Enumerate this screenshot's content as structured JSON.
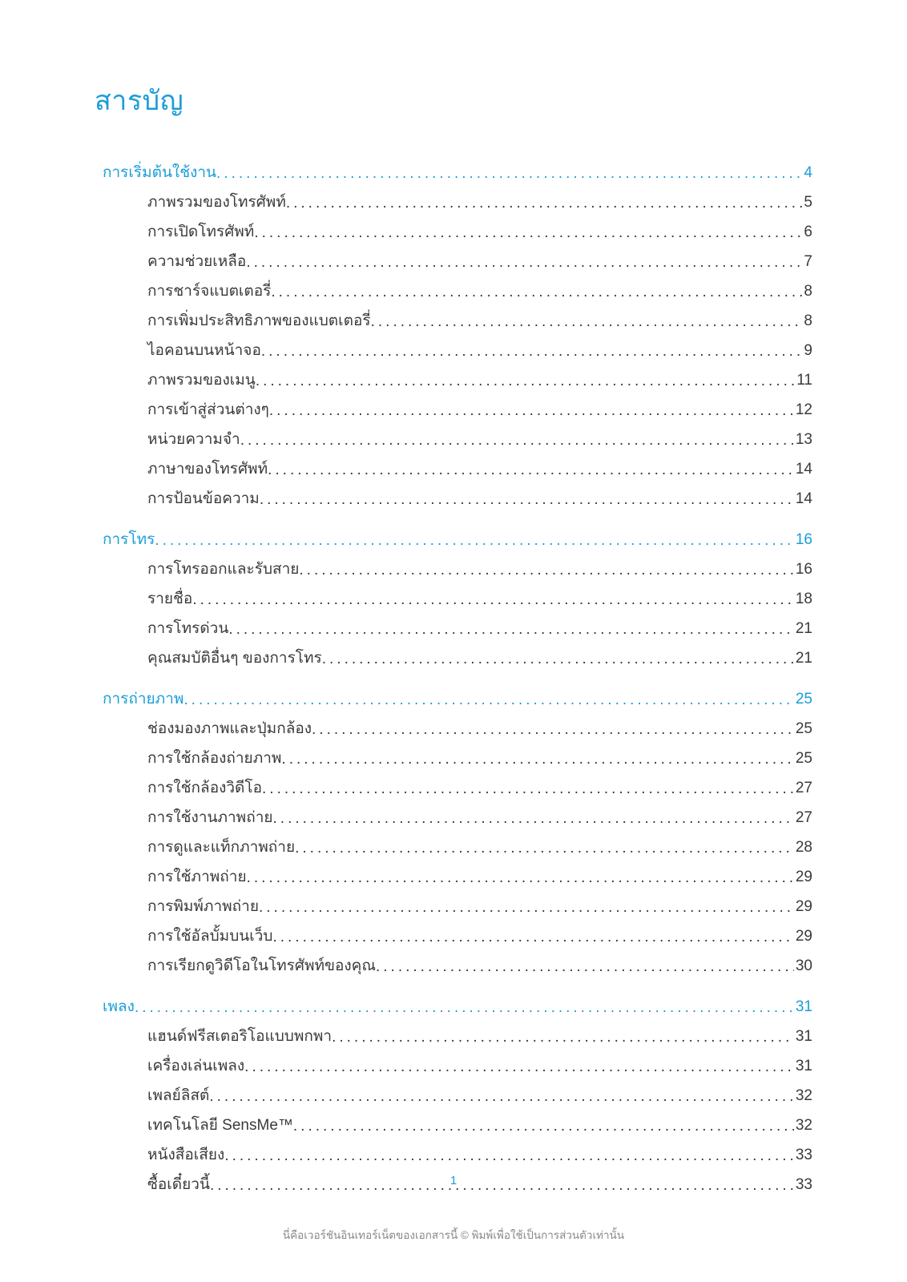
{
  "title": "สารบัญ",
  "sections": [
    {
      "heading": {
        "label": "การเริ่มต้นใช้งาน",
        "page": "4"
      },
      "items": [
        {
          "label": "ภาพรวมของโทรศัพท์ ",
          "page": "5"
        },
        {
          "label": "การเปิดโทรศัพท์",
          "page": "6"
        },
        {
          "label": "ความช่วยเหลือ",
          "page": "7"
        },
        {
          "label": "การชาร์จแบตเตอรี่",
          "page": "8"
        },
        {
          "label": "การเพิ่มประสิทธิภาพของแบตเตอรี่",
          "page": "8"
        },
        {
          "label": "ไอคอนบนหน้าจอ",
          "page": "9"
        },
        {
          "label": "ภาพรวมของเมนู",
          "page": "11"
        },
        {
          "label": "การเข้าสู่ส่วนต่างๆ",
          "page": "12"
        },
        {
          "label": "หน่วยความจำ",
          "page": "13"
        },
        {
          "label": "ภาษาของโทรศัพท์",
          "page": "14"
        },
        {
          "label": "การป้อนข้อความ",
          "page": "14"
        }
      ]
    },
    {
      "heading": {
        "label": "การโทร",
        "page": "16"
      },
      "items": [
        {
          "label": "การโทรออกและรับสาย",
          "page": "16"
        },
        {
          "label": "รายชื่อ ",
          "page": "18"
        },
        {
          "label": "การโทรด่วน",
          "page": "21"
        },
        {
          "label": "คุณสมบัติอื่นๆ ของการโทร",
          "page": "21"
        }
      ]
    },
    {
      "heading": {
        "label": "การถ่ายภาพ ",
        "page": "25"
      },
      "items": [
        {
          "label": "ช่องมองภาพและปุ่มกล้อง",
          "page": "25"
        },
        {
          "label": "การใช้กล้องถ่ายภาพ",
          "page": "25"
        },
        {
          "label": "การใช้กล้องวิดีโอ",
          "page": "27"
        },
        {
          "label": "การใช้งานภาพถ่าย",
          "page": "27"
        },
        {
          "label": "การดูและแท็กภาพถ่าย",
          "page": "28"
        },
        {
          "label": "การใช้ภาพถ่าย",
          "page": "29"
        },
        {
          "label": "การพิมพ์ภาพถ่าย",
          "page": "29"
        },
        {
          "label": "การใช้อัลบั้มบนเว็บ",
          "page": "29"
        },
        {
          "label": "การเรียกดูวิดีโอในโทรศัพท์ของคุณ",
          "page": "30"
        }
      ]
    },
    {
      "heading": {
        "label": "เพลง ",
        "page": "31"
      },
      "items": [
        {
          "label": "แฮนด์ฟรีสเตอริโอแบบพกพา",
          "page": "31"
        },
        {
          "label": "เครื่องเล่นเพลง",
          "page": "31"
        },
        {
          "label": "เพลย์ลิสต์",
          "page": "32"
        },
        {
          "label": "เทคโนโลยี SensMe™",
          "page": "32"
        },
        {
          "label": "หนังสือเสียง",
          "page": "33"
        },
        {
          "label": "ซื้อเดี๋ยวนี้",
          "page": "33"
        }
      ]
    }
  ],
  "page_number": "1",
  "copyright": "นี่คือเวอร์ชันอินเทอร์เน็ตของเอกสารนี้ © พิมพ์เพื่อใช้เป็นการส่วนตัวเท่านั้น"
}
